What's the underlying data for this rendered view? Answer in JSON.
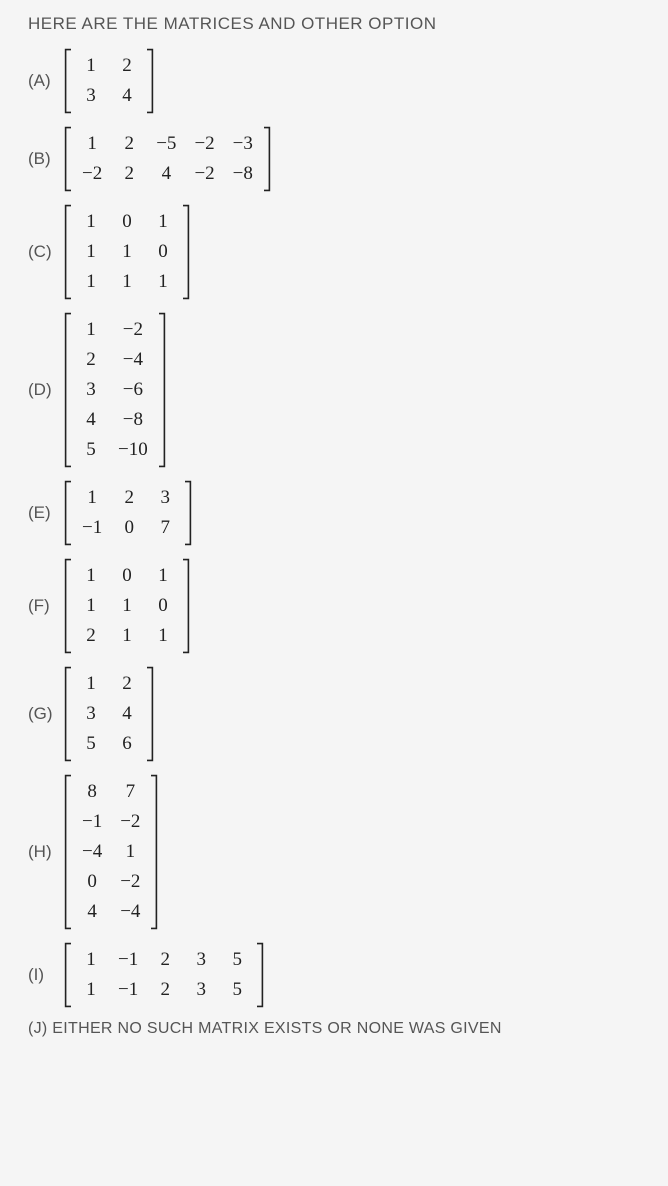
{
  "heading": "HERE ARE THE MATRICES AND OTHER OPTION",
  "options": [
    {
      "label": "(A)",
      "rows": [
        [
          "1",
          "2"
        ],
        [
          "3",
          "4"
        ]
      ]
    },
    {
      "label": "(B)",
      "rows": [
        [
          "1",
          "2",
          "−5",
          "−2",
          "−3"
        ],
        [
          "−2",
          "2",
          "4",
          "−2",
          "−8"
        ]
      ]
    },
    {
      "label": "(C)",
      "rows": [
        [
          "1",
          "0",
          "1"
        ],
        [
          "1",
          "1",
          "0"
        ],
        [
          "1",
          "1",
          "1"
        ]
      ]
    },
    {
      "label": "(D)",
      "rows": [
        [
          "1",
          "−2"
        ],
        [
          "2",
          "−4"
        ],
        [
          "3",
          "−6"
        ],
        [
          "4",
          "−8"
        ],
        [
          "5",
          "−10"
        ]
      ]
    },
    {
      "label": "(E)",
      "rows": [
        [
          "1",
          "2",
          "3"
        ],
        [
          "−1",
          "0",
          "7"
        ]
      ]
    },
    {
      "label": "(F)",
      "rows": [
        [
          "1",
          "0",
          "1"
        ],
        [
          "1",
          "1",
          "0"
        ],
        [
          "2",
          "1",
          "1"
        ]
      ]
    },
    {
      "label": "(G)",
      "rows": [
        [
          "1",
          "2"
        ],
        [
          "3",
          "4"
        ],
        [
          "5",
          "6"
        ]
      ]
    },
    {
      "label": "(H)",
      "rows": [
        [
          "8",
          "7"
        ],
        [
          "−1",
          "−2"
        ],
        [
          "−4",
          "1"
        ],
        [
          "0",
          "−2"
        ],
        [
          "4",
          "−4"
        ]
      ]
    },
    {
      "label": "(I)",
      "rows": [
        [
          "1",
          "−1",
          "2",
          "3",
          "5"
        ],
        [
          "1",
          "−1",
          "2",
          "3",
          "5"
        ]
      ]
    }
  ],
  "footer": "(J) EITHER NO SUCH MATRIX EXISTS OR NONE WAS GIVEN"
}
